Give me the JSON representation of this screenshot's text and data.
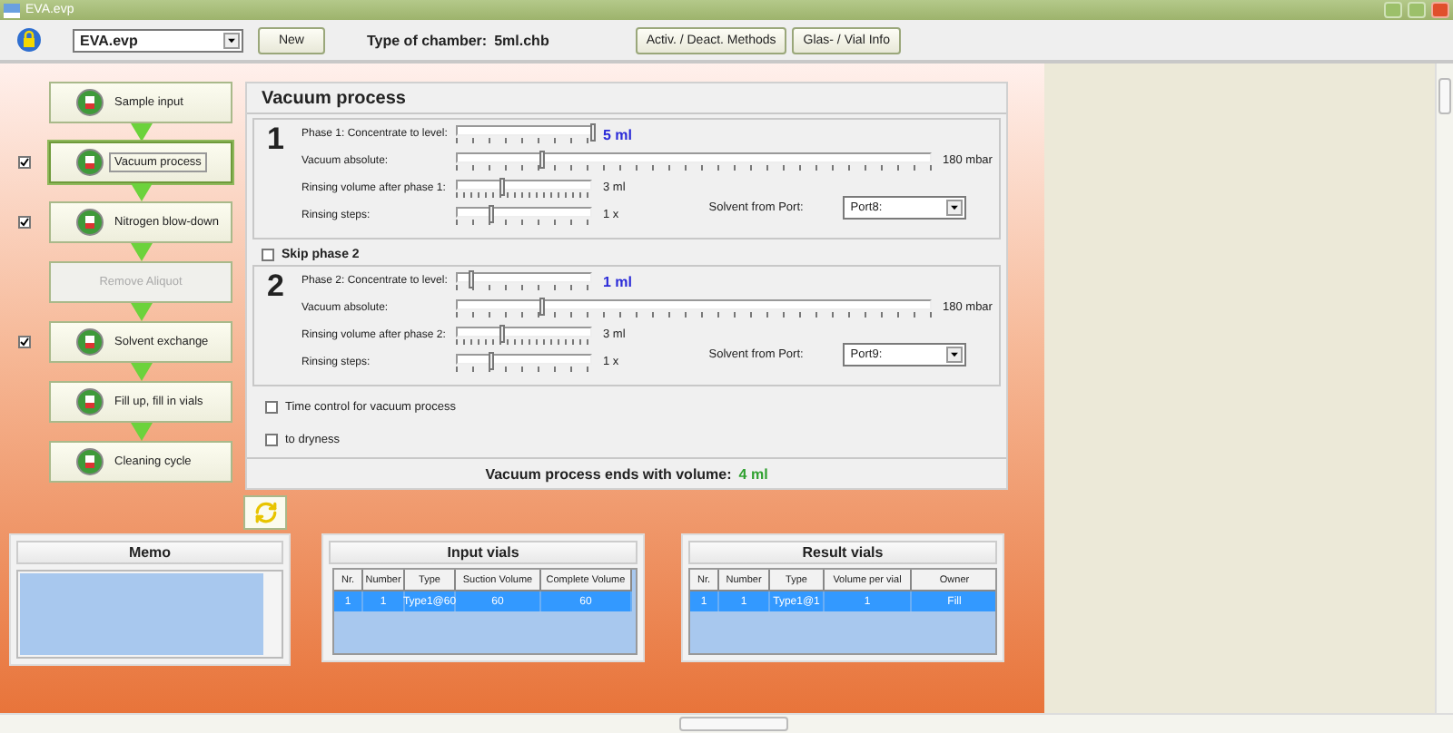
{
  "window": {
    "title": "EVA.evp"
  },
  "toolbar": {
    "method": "EVA.evp",
    "new_button": "New",
    "chamber_label": "Type of chamber:",
    "chamber_value": "5ml.chb",
    "buttons": [
      "Activ. / Deact. Methods",
      "Glas- / Vial Info"
    ]
  },
  "workflow": [
    {
      "label": "Sample input",
      "kind": "fixed",
      "disabled": false,
      "selected": false
    },
    {
      "label": "Vacuum process",
      "kind": "optional",
      "checked": true,
      "disabled": false,
      "selected": true
    },
    {
      "label": "Nitrogen blow-down",
      "kind": "optional",
      "checked": true,
      "disabled": false,
      "selected": false
    },
    {
      "label": "Remove Aliquot",
      "kind": "fixed",
      "disabled": true,
      "selected": false
    },
    {
      "label": "Solvent exchange",
      "kind": "optional",
      "checked": true,
      "disabled": false,
      "selected": false
    },
    {
      "label": "Fill up, fill in vials",
      "kind": "fixed",
      "disabled": false,
      "selected": false
    },
    {
      "label": "Cleaning cycle",
      "kind": "fixed",
      "disabled": false,
      "selected": false
    }
  ],
  "vacuum": {
    "title": "Vacuum process",
    "phases": [
      {
        "number": "1",
        "rows": [
          {
            "label": "Phase 1: Concentrate to level:",
            "kind": "target",
            "level": 1,
            "reading": "5 ml"
          },
          {
            "label": "Vacuum absolute:",
            "kind": "wide",
            "level": 0.18,
            "reading": "180 mbar"
          },
          {
            "label": "Rinsing volume after phase 1:",
            "kind": "short",
            "level": 0.33,
            "reading": "3 ml"
          },
          {
            "label": "Rinsing steps:",
            "kind": "short",
            "level": 0.25,
            "reading": "1 x"
          }
        ],
        "port": {
          "label": "Solvent from Port:",
          "value": "Port8:"
        }
      },
      {
        "number": "2",
        "skip": {
          "label": "Skip phase 2",
          "checked": false
        },
        "rows": [
          {
            "label": "Phase 2: Concentrate to level:",
            "kind": "target",
            "level": 0.1,
            "reading": "1 ml"
          },
          {
            "label": "Vacuum absolute:",
            "kind": "wide",
            "level": 0.18,
            "reading": "180 mbar"
          },
          {
            "label": "Rinsing volume after phase 2:",
            "kind": "short",
            "level": 0.33,
            "reading": "3 ml"
          },
          {
            "label": "Rinsing steps:",
            "kind": "short",
            "level": 0.25,
            "reading": "1 x"
          }
        ],
        "port": {
          "label": "Solvent from Port:",
          "value": "Port9:"
        }
      }
    ],
    "options": [
      {
        "label": "Time control for vacuum process",
        "checked": false
      },
      {
        "label": "to dryness",
        "checked": false
      }
    ],
    "result_label": "Vacuum process ends with volume:",
    "result_value": "4 ml"
  },
  "memo": {
    "title": "Memo"
  },
  "input_vials": {
    "title": "Input vials",
    "columns": [
      "Nr.",
      "Number",
      "Type",
      "Suction Volume",
      "Complete Volume"
    ],
    "rows": [
      {
        "cells": [
          "1",
          "1",
          "Type1@60",
          "60",
          "60"
        ],
        "selected": true
      }
    ]
  },
  "result_vials": {
    "title": "Result vials",
    "columns": [
      "Nr.",
      "Number",
      "Type",
      "Volume per vial",
      "Owner"
    ],
    "rows": [
      {
        "cells": [
          "1",
          "1",
          "Type1@1",
          "1",
          "Fill"
        ],
        "selected": true
      }
    ]
  }
}
